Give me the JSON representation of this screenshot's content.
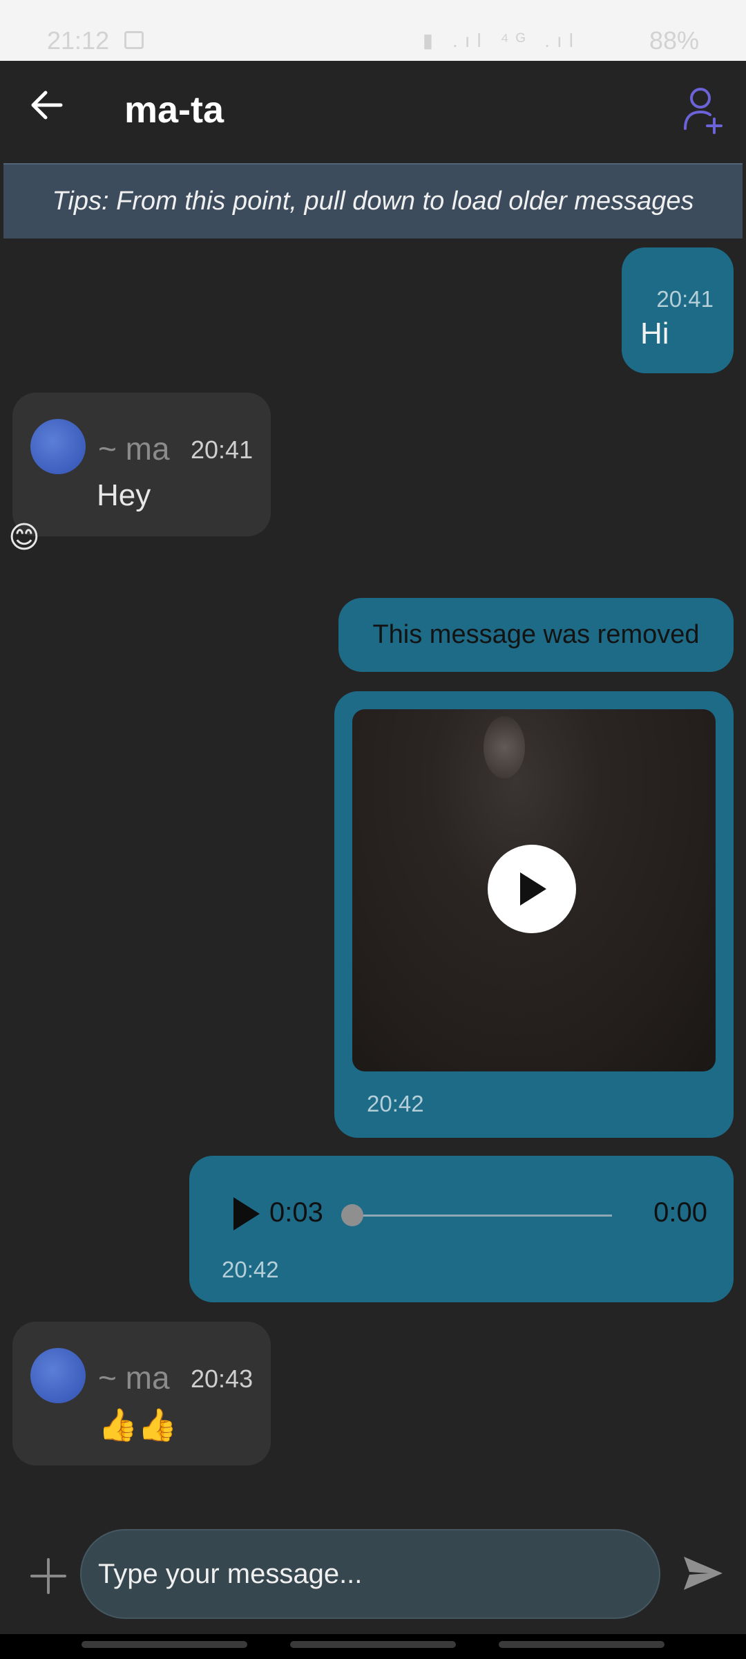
{
  "status_bar": {
    "time": "21:12",
    "icons": "▮ .ıl ⁴ᴳ .ıl",
    "battery": "88%"
  },
  "header": {
    "title": "ma-ta"
  },
  "tips": {
    "text": "Tips: From this point, pull down to load older messages"
  },
  "messages": [
    {
      "direction": "out",
      "text": "Hi",
      "time": "20:41"
    },
    {
      "direction": "in",
      "sender": "~ ma",
      "text": "Hey",
      "time": "20:41",
      "reaction": "😊"
    },
    {
      "direction": "out",
      "text": "This message was removed"
    },
    {
      "direction": "out",
      "type": "video",
      "time": "20:42"
    },
    {
      "direction": "out",
      "type": "audio",
      "duration": "0:03",
      "position": "0:00",
      "progress": 0,
      "time": "20:42"
    },
    {
      "direction": "in",
      "sender": "~ ma",
      "text": "👍👍",
      "time": "20:43"
    }
  ],
  "composer": {
    "placeholder": "Type your message..."
  },
  "colors": {
    "background": "#242424",
    "outgoing_bubble": "#1e6b88",
    "incoming_bubble": "#333333",
    "accent": "#6c63d8"
  },
  "icons": {
    "back": "arrow-left-icon",
    "add_contact": "user-plus-icon",
    "attach": "plus-icon",
    "send": "send-icon",
    "play": "play-icon"
  }
}
